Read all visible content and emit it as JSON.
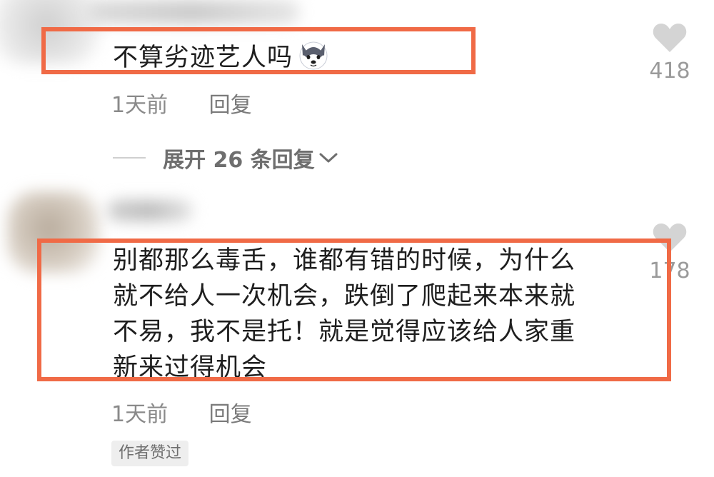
{
  "comments": [
    {
      "text": "不算劣迹艺人吗",
      "emoji": "husky-dog-emoji",
      "time": "1天前",
      "reply_label": "回复",
      "likes": "418",
      "expand_label": "展开 26 条回复"
    },
    {
      "lines": [
        "别都那么毒舌，谁都有错的时候，为什么",
        "就不给人一次机会，跌倒了爬起来本来就",
        "不易，我不是托！就是觉得应该给人家重",
        "新来过得机会"
      ],
      "time": "1天前",
      "reply_label": "回复",
      "likes": "178",
      "badge": "作者赞过"
    }
  ],
  "colors": {
    "highlight": "#f06a46",
    "text": "#1e1e1e",
    "meta": "#8a8a8a",
    "heart": "#d4d4d4"
  },
  "icons": {
    "like": "heart-icon",
    "expand": "chevron-down-icon"
  }
}
